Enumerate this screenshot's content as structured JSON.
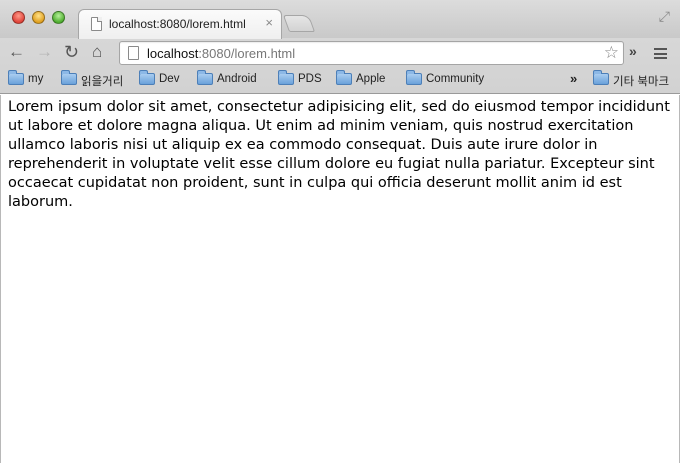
{
  "tab": {
    "title": "localhost:8080/lorem.html",
    "close_glyph": "×"
  },
  "address_bar": {
    "host": "localhost",
    "rest": ":8080/lorem.html"
  },
  "toolbar": {
    "back_glyph": "←",
    "forward_glyph": "→",
    "reload_glyph": "↻",
    "home_glyph": "⌂",
    "star_glyph": "☆",
    "extensions_glyph": "»"
  },
  "bookmarks": {
    "items": [
      "my",
      "읽을거리",
      "Dev",
      "Android",
      "PDS",
      "Apple",
      "Community"
    ],
    "overflow_glyph": "»",
    "other": "기타 북마크"
  },
  "page": {
    "text": "Lorem ipsum dolor sit amet, consectetur adipisicing elit, sed do eiusmod tempor incididunt ut labore et dolore magna aliqua. Ut enim ad minim veniam, quis nostrud exercitation ullamco laboris nisi ut aliquip ex ea commodo consequat. Duis aute irure dolor in reprehenderit in voluptate velit esse cillum dolore eu fugiat nulla pariatur. Excepteur sint occaecat cupidatat non proident, sunt in culpa qui officia deserunt mollit anim id est laborum."
  }
}
